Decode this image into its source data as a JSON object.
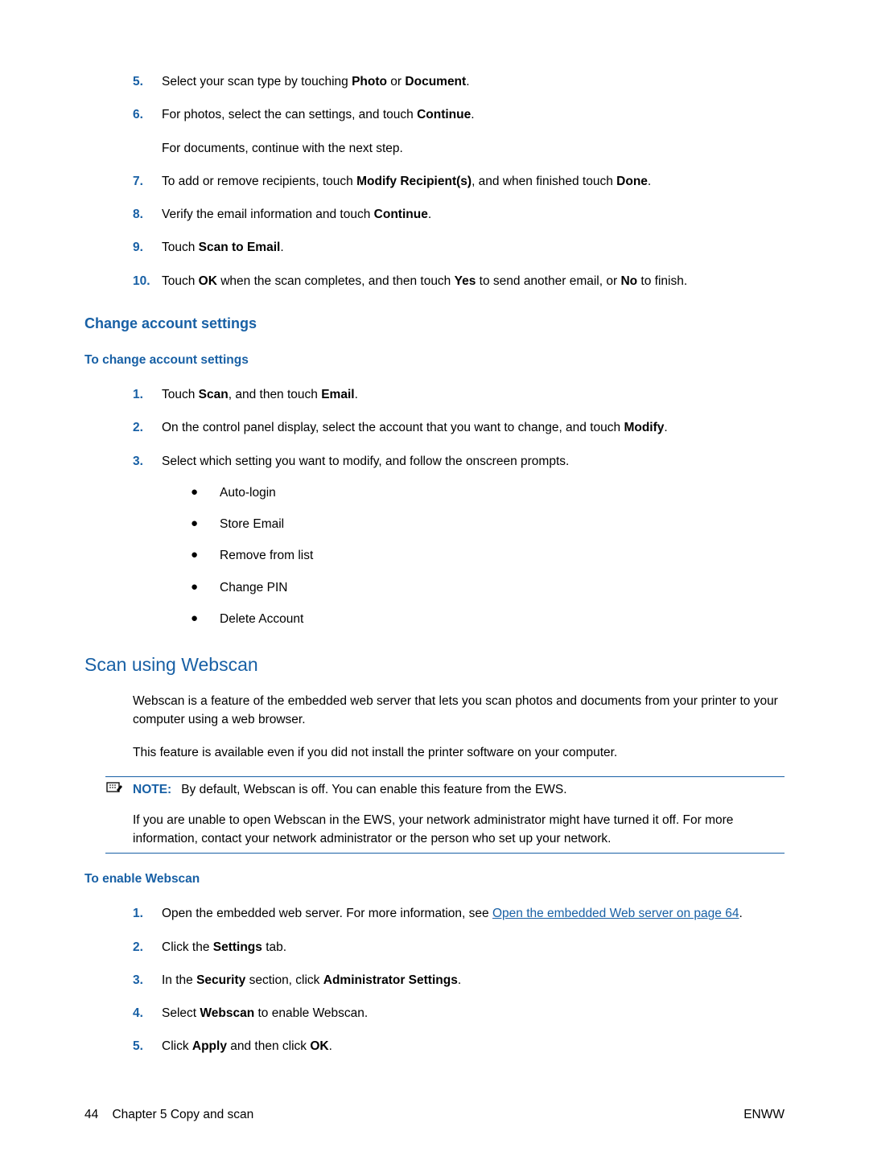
{
  "steps_a": {
    "s5": {
      "num": "5.",
      "pre": "Select your scan type by touching ",
      "b1": "Photo",
      "mid": " or ",
      "b2": "Document",
      "post": "."
    },
    "s6": {
      "num": "6.",
      "pre": "For photos, select the can settings, and touch ",
      "b1": "Continue",
      "post": ".",
      "sub": "For documents, continue with the next step."
    },
    "s7": {
      "num": "7.",
      "pre": "To add or remove recipients, touch ",
      "b1": "Modify Recipient(s)",
      "mid": ", and when finished touch ",
      "b2": "Done",
      "post": "."
    },
    "s8": {
      "num": "8.",
      "pre": "Verify the email information and touch ",
      "b1": "Continue",
      "post": "."
    },
    "s9": {
      "num": "9.",
      "pre": "Touch ",
      "b1": "Scan to Email",
      "post": "."
    },
    "s10": {
      "num": "10.",
      "pre": "Touch ",
      "b1": "OK",
      "mid1": " when the scan completes, and then touch ",
      "b2": "Yes",
      "mid2": " to send another email, or ",
      "b3": "No",
      "post": " to finish."
    }
  },
  "heading_change": "Change account settings",
  "heading_to_change": "To change account settings",
  "steps_b": {
    "s1": {
      "num": "1.",
      "pre": "Touch ",
      "b1": "Scan",
      "mid": ", and then touch ",
      "b2": "Email",
      "post": "."
    },
    "s2": {
      "num": "2.",
      "pre": "On the control panel display, select the account that you want to change, and touch ",
      "b1": "Modify",
      "post": "."
    },
    "s3": {
      "num": "3.",
      "text": "Select which setting you want to modify, and follow the onscreen prompts."
    }
  },
  "bullets": [
    "Auto-login",
    "Store Email",
    "Remove from list",
    "Change PIN",
    "Delete Account"
  ],
  "heading_webscan": "Scan using Webscan",
  "webscan_para1": "Webscan is a feature of the embedded web server that lets you scan photos and documents from your printer to your computer using a web browser.",
  "webscan_para2": "This feature is available even if you did not install the printer software on your computer.",
  "note": {
    "label": "NOTE:",
    "text1": "By default, Webscan is off. You can enable this feature from the EWS.",
    "text2": "If you are unable to open Webscan in the EWS, your network administrator might have turned it off. For more information, contact your network administrator or the person who set up your network."
  },
  "heading_enable": "To enable Webscan",
  "steps_c": {
    "s1": {
      "num": "1.",
      "pre": "Open the embedded web server. For more information, see ",
      "link": "Open the embedded Web server on page 64",
      "post": "."
    },
    "s2": {
      "num": "2.",
      "pre": "Click the ",
      "b1": "Settings",
      "post": " tab."
    },
    "s3": {
      "num": "3.",
      "pre": "In the ",
      "b1": "Security",
      "mid": " section, click ",
      "b2": "Administrator Settings",
      "post": "."
    },
    "s4": {
      "num": "4.",
      "pre": "Select ",
      "b1": "Webscan",
      "post": " to enable Webscan."
    },
    "s5": {
      "num": "5.",
      "pre": "Click ",
      "b1": "Apply",
      "mid": " and then click ",
      "b2": "OK",
      "post": "."
    }
  },
  "footer": {
    "page": "44",
    "chapter": "Chapter 5   Copy and scan",
    "right": "ENWW"
  }
}
